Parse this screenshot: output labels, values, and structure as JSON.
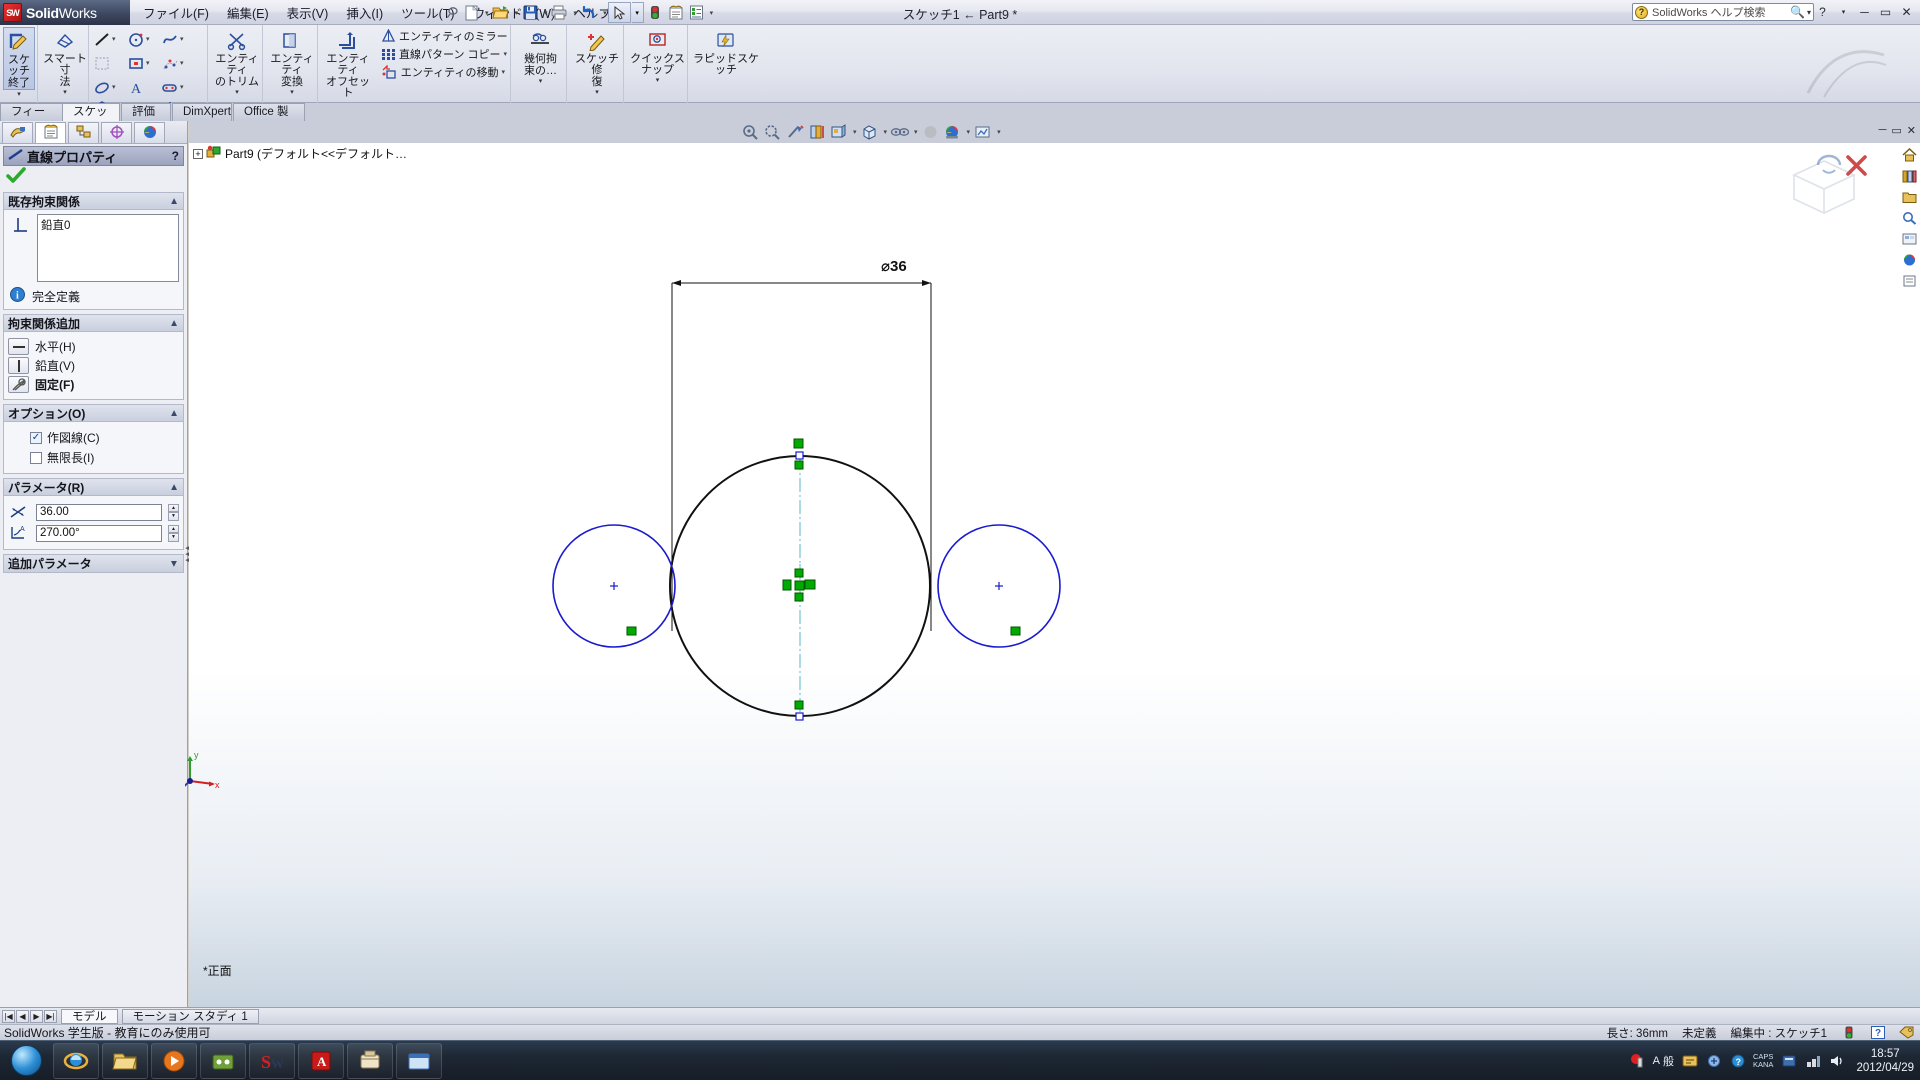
{
  "app": {
    "brand_solid": "Solid",
    "brand_works": "Works",
    "logo_text": "SW",
    "title": "スケッチ1 ← Part9 *"
  },
  "menubar": {
    "items": [
      {
        "label": "ファイル(F)",
        "name": "menu-file"
      },
      {
        "label": "編集(E)",
        "name": "menu-edit"
      },
      {
        "label": "表示(V)",
        "name": "menu-view"
      },
      {
        "label": "挿入(I)",
        "name": "menu-insert"
      },
      {
        "label": "ツール(T)",
        "name": "menu-tools"
      },
      {
        "label": "ウィンドウ(W)",
        "name": "menu-window"
      },
      {
        "label": "ヘルプ(H)",
        "name": "menu-help"
      }
    ],
    "pin_icon": "pushpin-icon"
  },
  "search": {
    "placeholder": "SolidWorks ヘルプ検索",
    "icon": "help-search-icon"
  },
  "window_controls": {
    "help": "?",
    "help_dropdown": "▾",
    "minimize": "─",
    "restore": "▭",
    "close": "✕"
  },
  "quickaccess": {
    "buttons": [
      {
        "name": "new-document-button",
        "icon": "new-file-icon"
      },
      {
        "name": "open-document-button",
        "icon": "open-folder-icon"
      },
      {
        "name": "save-button",
        "icon": "floppy-save-icon"
      },
      {
        "name": "print-button",
        "icon": "printer-icon"
      },
      {
        "name": "undo-button",
        "icon": "undo-arrow-icon"
      },
      {
        "name": "select-button",
        "icon": "cursor-arrow-icon"
      },
      {
        "name": "rebuild-button",
        "icon": "traffic-light-icon"
      },
      {
        "name": "options-button",
        "icon": "options-gear-icon"
      },
      {
        "name": "customize-button",
        "icon": "checklist-icon"
      }
    ]
  },
  "ribbon": {
    "sketch_exit": {
      "line1": "スケッチ",
      "line2": "終了",
      "icon": "exit-sketch-icon"
    },
    "smart_dimension": {
      "line1": "スマート寸",
      "line2": "法",
      "icon": "smart-dimension-icon"
    },
    "sketch_entities": [
      {
        "name": "line-tool",
        "icon": "line-icon"
      },
      {
        "name": "circle-tool",
        "icon": "circle-icon"
      },
      {
        "name": "spline-tool",
        "icon": "spline-icon"
      },
      {
        "name": "sketch-pattern-tool",
        "icon": "dotted-rect-icon"
      },
      {
        "name": "rectangle-tool",
        "icon": "rectangle-icon"
      },
      {
        "name": "sketch-points-tool",
        "icon": "points-icon"
      },
      {
        "name": "ellipse-tool",
        "icon": "ellipse-icon"
      },
      {
        "name": "text-tool",
        "icon": "text-A-icon"
      },
      {
        "name": "slot-tool",
        "icon": "slot-icon"
      },
      {
        "name": "polygon-tool",
        "icon": "polygon-icon"
      },
      {
        "name": "arc-tool",
        "icon": "arc-icon"
      },
      {
        "name": "point-tool",
        "icon": "asterisk-point-icon"
      }
    ],
    "trim": {
      "line1": "エンティティ",
      "line2": "のトリム",
      "icon": "trim-entities-icon"
    },
    "convert": {
      "line1": "エンティティ",
      "line2": "変換",
      "icon": "convert-entities-icon"
    },
    "offset": {
      "line1": "エンティティ",
      "line2": "オフセット",
      "icon": "offset-entities-icon"
    },
    "side_tools": [
      {
        "label": "エンティティのミラー",
        "name": "mirror-entities",
        "icon": "mirror-icon"
      },
      {
        "label": "直線パターン コピー",
        "name": "linear-pattern",
        "icon": "linear-pattern-icon"
      },
      {
        "label": "エンティティの移動",
        "name": "move-entities",
        "icon": "move-entities-icon"
      }
    ],
    "display_relations": {
      "line1": "幾何拘",
      "line2": "束の…",
      "icon": "display-relations-icon"
    },
    "repair_sketch": {
      "line1": "スケッチ修",
      "line2": "復",
      "icon": "repair-sketch-icon"
    },
    "quick_snaps": {
      "label": "クイックスナップ",
      "icon": "quick-snaps-icon"
    },
    "rapid_sketch": {
      "label": "ラピッドスケッチ",
      "icon": "rapid-sketch-icon"
    }
  },
  "tabs": [
    {
      "label": "フィーチャー",
      "name": "tab-features",
      "active": false
    },
    {
      "label": "スケッチ",
      "name": "tab-sketch",
      "active": true
    },
    {
      "label": "評価",
      "name": "tab-evaluate",
      "active": false
    },
    {
      "label": "DimXpert",
      "name": "tab-dimxpert",
      "active": false
    },
    {
      "label": "Office 製品",
      "name": "tab-office-products",
      "active": false
    }
  ],
  "property_manager": {
    "tabs": [
      {
        "name": "feature-manager-tab",
        "icon": "feature-tree-icon"
      },
      {
        "name": "property-manager-tab",
        "icon": "property-manager-icon"
      },
      {
        "name": "configuration-manager-tab",
        "icon": "configuration-icon"
      },
      {
        "name": "dimxpert-manager-tab",
        "icon": "dimxpert-icon"
      },
      {
        "name": "display-manager-tab",
        "icon": "display-manager-icon"
      }
    ],
    "header": {
      "title": "直線プロパティ",
      "help": "?",
      "icon": "line-properties-icon"
    },
    "ok_icon": "green-check-icon",
    "existing_relations": {
      "title": "既存拘束関係",
      "icon": "relation-perpendicular-icon",
      "items": [
        "鉛直0"
      ],
      "status_icon": "info-icon",
      "status": "完全定義"
    },
    "add_relations": {
      "title": "拘束関係追加",
      "buttons": [
        {
          "label": "水平(H)",
          "name": "relation-horizontal",
          "icon": "horizontal-line-icon",
          "bold": false
        },
        {
          "label": "鉛直(V)",
          "name": "relation-vertical",
          "icon": "vertical-line-icon",
          "bold": false
        },
        {
          "label": "固定(F)",
          "name": "relation-fix",
          "icon": "fix-anchor-icon",
          "bold": true
        }
      ]
    },
    "options": {
      "title": "オプション(O)",
      "items": [
        {
          "label": "作図線(C)",
          "name": "option-construction-line",
          "checked": true
        },
        {
          "label": "無限長(I)",
          "name": "option-infinite-length",
          "checked": false
        }
      ]
    },
    "parameters": {
      "title": "パラメータ(R)",
      "fields": [
        {
          "name": "param-length",
          "icon": "length-icon",
          "value": "36.00"
        },
        {
          "name": "param-angle",
          "icon": "angle-icon",
          "value": "270.00°"
        }
      ]
    },
    "additional_parameters": {
      "title": "追加パラメータ"
    }
  },
  "feature_tree": {
    "root": "Part9  (デフォルト<<デフォルト…",
    "expander": "+",
    "icon": "part-icon"
  },
  "view_toolbar": {
    "buttons": [
      {
        "name": "zoom-to-fit-button",
        "icon": "zoom-fit-icon"
      },
      {
        "name": "zoom-to-area-button",
        "icon": "zoom-area-icon"
      },
      {
        "name": "previous-view-button",
        "icon": "previous-view-icon"
      },
      {
        "name": "section-view-button",
        "icon": "section-view-icon"
      },
      {
        "name": "view-orientation-button",
        "icon": "view-orientation-icon"
      },
      {
        "name": "display-style-button",
        "icon": "display-style-icon"
      },
      {
        "name": "hide-show-items-button",
        "icon": "hide-show-icon"
      },
      {
        "name": "edit-appearance-button",
        "icon": "appearance-sphere-icon"
      },
      {
        "name": "apply-scene-button",
        "icon": "scene-icon"
      },
      {
        "name": "view-settings-button",
        "icon": "view-settings-icon"
      }
    ]
  },
  "right_toolbar": {
    "buttons": [
      {
        "name": "home-panel-button",
        "icon": "home-icon"
      },
      {
        "name": "design-library-button",
        "icon": "library-icon"
      },
      {
        "name": "file-explorer-button",
        "icon": "explorer-icon"
      },
      {
        "name": "search-panel-button",
        "icon": "search-icon"
      },
      {
        "name": "view-palette-button",
        "icon": "palette-icon"
      },
      {
        "name": "appearances-panel-button",
        "icon": "appearances-icon"
      },
      {
        "name": "custom-properties-button",
        "icon": "custom-properties-icon"
      }
    ]
  },
  "graphics": {
    "dimension_label": "36",
    "dimension_symbol": "⌀",
    "view_label": "正面",
    "origin_x_label": "x",
    "origin_y_label": "y",
    "confirm_ok_icon": "confirm-ok-icon",
    "confirm_cancel_icon": "confirm-cancel-icon",
    "watermark": "solidworks-watermark"
  },
  "bottom_tabs": [
    {
      "label": "モデル",
      "name": "bottom-tab-model",
      "active": true
    },
    {
      "label": "モーション スタディ 1",
      "name": "bottom-tab-motion-study",
      "active": false
    }
  ],
  "status_bar": {
    "license": "SolidWorks 学生版 - 教育にのみ使用可",
    "length": "長さ: 36mm",
    "state": "未定義",
    "editing": "編集中 : スケッチ1",
    "rebuild_icon": "traffic-light-icon",
    "help_icon": "question-help-icon",
    "tag_icon": "tag-icon"
  },
  "taskbar": {
    "start_icon": "windows-start-orb",
    "items": [
      {
        "name": "taskbar-internet-explorer",
        "icon": "ie-icon"
      },
      {
        "name": "taskbar-explorer",
        "icon": "folder-icon"
      },
      {
        "name": "taskbar-media-player",
        "icon": "media-player-icon"
      },
      {
        "name": "taskbar-app-4",
        "icon": "app-icon"
      },
      {
        "name": "taskbar-solidworks",
        "icon": "solidworks-icon"
      },
      {
        "name": "taskbar-acrobat",
        "icon": "acrobat-icon"
      },
      {
        "name": "taskbar-app-7",
        "icon": "app-icon"
      },
      {
        "name": "taskbar-app-8",
        "icon": "window-icon"
      }
    ],
    "ime": {
      "mode": "般",
      "caps": "CAPS",
      "kana": "KANA"
    },
    "clock_time": "18:57",
    "clock_date": "2012/04/29"
  }
}
